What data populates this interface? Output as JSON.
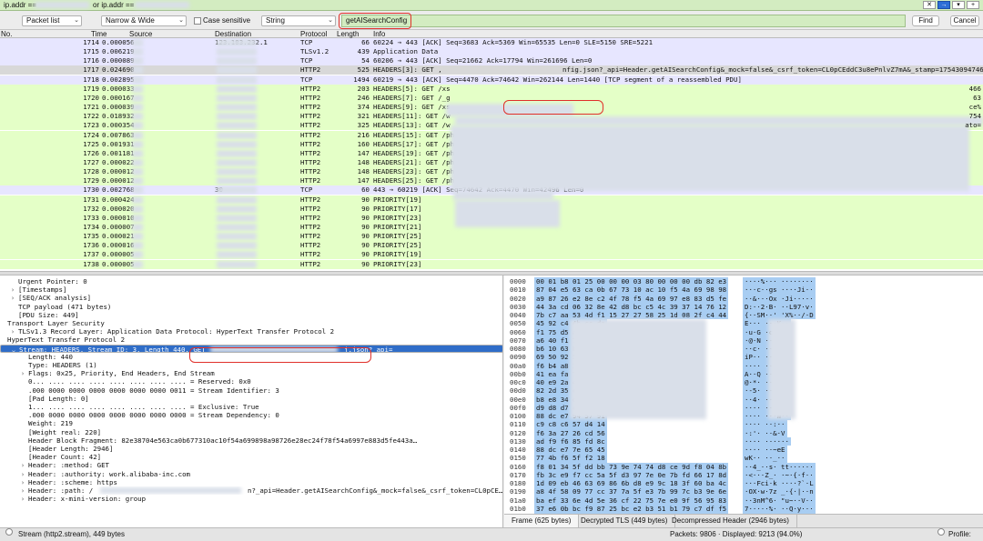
{
  "filter": {
    "text": "ip.addr ==",
    "or_text": "or ip.addr =="
  },
  "search": {
    "scope": "Packet list",
    "char_width": "Narrow & Wide",
    "case_label": "Case sensitive",
    "type": "String",
    "value": "getAISearchConfig",
    "find_label": "Find",
    "cancel_label": "Cancel"
  },
  "columns": [
    "No.",
    "Time",
    "Source",
    "Destination",
    "Protocol",
    "Length",
    "Info"
  ],
  "packets": [
    {
      "no": "1714",
      "time": "0.000056",
      "dst": "123.183.232.1",
      "proto": "TCP",
      "len": "66",
      "info": "60224 → 443 [ACK] Seq=3683 Ack=5369 Win=65535 Len=0 SLE=5150 SRE=5221",
      "kind": "tcp"
    },
    {
      "no": "1715",
      "time": "0.006219",
      "dst": "",
      "proto": "TLSv1.2",
      "len": "439",
      "info": "Application Data",
      "kind": "tcp"
    },
    {
      "no": "1716",
      "time": "0.000089",
      "dst": "",
      "proto": "TCP",
      "len": "54",
      "info": "60206 → 443 [ACK] Seq=21662 Ack=17794 Win=261696 Len=0",
      "kind": "tcp"
    },
    {
      "no": "1717",
      "time": "0.024690",
      "dst": "",
      "proto": "HTTP2",
      "len": "525",
      "info": "HEADERS[3]: GET ,",
      "info2": "nfig.json?_api=Header.getAISearchConfig&_mock=false&_csrf_token=CL0pCEddC3u8ePnlvZ7mA&_stamp=17543094746",
      "kind": "sel"
    },
    {
      "no": "1718",
      "time": "0.002895",
      "dst": "",
      "proto": "TCP",
      "len": "1494",
      "info": "60219 → 443 [ACK] Seq=4470 Ack=74642 Win=262144 Len=1440 [TCP segment of a reassembled PDU]",
      "kind": "tcp"
    },
    {
      "no": "1719",
      "time": "0.000033",
      "dst": "",
      "proto": "HTTP2",
      "len": "203",
      "info": "HEADERS[5]: GET /xs",
      "kind": "http2"
    },
    {
      "no": "1720",
      "time": "0.000167",
      "dst": "",
      "proto": "HTTP2",
      "len": "246",
      "info": "HEADERS[7]: GET /_g",
      "kind": "http2"
    },
    {
      "no": "1721",
      "time": "0.000039",
      "dst": "",
      "proto": "HTTP2",
      "len": "374",
      "info": "HEADERS[9]: GET /xs",
      "kind": "http2"
    },
    {
      "no": "1722",
      "time": "0.018932",
      "dst": "",
      "proto": "HTTP2",
      "len": "321",
      "info": "HEADERS[11]: GET /w",
      "kind": "http2"
    },
    {
      "no": "1723",
      "time": "0.000354",
      "dst": "",
      "proto": "HTTP2",
      "len": "325",
      "info": "HEADERS[13]: GET /w",
      "kind": "http2"
    },
    {
      "no": "1724",
      "time": "0.007863",
      "dst": "",
      "proto": "HTTP2",
      "len": "216",
      "info": "HEADERS[15]: GET /photo/undefined_80x80.jpg",
      "kind": "http2"
    },
    {
      "no": "1725",
      "time": "0.001931",
      "dst": "",
      "proto": "HTTP2",
      "len": "160",
      "info": "HEADERS[17]: GET /ph",
      "info2": "4309474653",
      "kind": "http2"
    },
    {
      "no": "1726",
      "time": "0.001181",
      "dst": "",
      "proto": "HTTP2",
      "len": "147",
      "info": "HEADERS[19]: GET /ph",
      "kind": "http2"
    },
    {
      "no": "1727",
      "time": "0.000022",
      "dst": "",
      "proto": "HTTP2",
      "len": "148",
      "info": "HEADERS[21]: GET /ph",
      "kind": "http2"
    },
    {
      "no": "1728",
      "time": "0.000012",
      "dst": "",
      "proto": "HTTP2",
      "len": "148",
      "info": "HEADERS[23]: GET /ph",
      "kind": "http2"
    },
    {
      "no": "1729",
      "time": "0.000012",
      "dst": "",
      "proto": "HTTP2",
      "len": "147",
      "info": "HEADERS[25]: GET /ph",
      "kind": "http2"
    },
    {
      "no": "1730",
      "time": "0.002768",
      "dst": "30",
      "proto": "TCP",
      "len": "60",
      "info": "443 → 60219 [ACK] Seq=74642 Ack=4470 Win=42496 Len=0",
      "kind": "tcp"
    },
    {
      "no": "1731",
      "time": "0.000424",
      "dst": "",
      "proto": "HTTP2",
      "len": "90",
      "info": "PRIORITY[19]",
      "kind": "http2"
    },
    {
      "no": "1732",
      "time": "0.000020",
      "dst": "",
      "proto": "HTTP2",
      "len": "90",
      "info": "PRIORITY[17]",
      "kind": "http2"
    },
    {
      "no": "1733",
      "time": "0.000010",
      "dst": "",
      "proto": "HTTP2",
      "len": "90",
      "info": "PRIORITY[23]",
      "kind": "http2"
    },
    {
      "no": "1734",
      "time": "0.000007",
      "dst": "",
      "proto": "HTTP2",
      "len": "90",
      "info": "PRIORITY[21]",
      "kind": "http2"
    },
    {
      "no": "1735",
      "time": "0.000021",
      "dst": "",
      "proto": "HTTP2",
      "len": "90",
      "info": "PRIORITY[25]",
      "kind": "http2"
    },
    {
      "no": "1736",
      "time": "0.000016",
      "dst": "",
      "proto": "HTTP2",
      "len": "90",
      "info": "PRIORITY[25]",
      "kind": "http2"
    },
    {
      "no": "1737",
      "time": "0.000005",
      "dst": "",
      "proto": "HTTP2",
      "len": "90",
      "info": "PRIORITY[19]",
      "kind": "http2"
    },
    {
      "no": "1738",
      "time": "0.000005",
      "dst": "",
      "proto": "HTTP2",
      "len": "90",
      "info": "PRIORITY[23]",
      "kind": "http2"
    }
  ],
  "info_tails": [
    {
      "row": 5,
      "text": "466"
    },
    {
      "row": 6,
      "text": "63"
    },
    {
      "row": 7,
      "text": "ce%"
    },
    {
      "row": 8,
      "text": "754"
    },
    {
      "row": 9,
      "text": "ato="
    }
  ],
  "details": [
    {
      "indent": 0,
      "arrow": "",
      "text": "Urgent Pointer: 0"
    },
    {
      "indent": 0,
      "arrow": "›",
      "text": "[Timestamps]"
    },
    {
      "indent": 0,
      "arrow": "›",
      "text": "[SEQ/ACK analysis]"
    },
    {
      "indent": 0,
      "arrow": "",
      "text": "TCP payload (471 bytes)"
    },
    {
      "indent": 0,
      "arrow": "",
      "text": "[PDU Size: 449]"
    },
    {
      "indent": -1,
      "arrow": "",
      "text": "Transport Layer Security"
    },
    {
      "indent": 0,
      "arrow": "›",
      "text": "TLSv1.3 Record Layer: Application Data Protocol: HyperText Transfer Protocol 2"
    },
    {
      "indent": -1,
      "arrow": "",
      "text": "HyperText Transfer Protocol 2"
    },
    {
      "indent": 0,
      "arrow": "⌄",
      "text": "Stream: HEADERS, Stream ID: 3, Length 440, GET",
      "text2": "j.json?_api=",
      "selected": true
    },
    {
      "indent": 1,
      "arrow": "",
      "text": "Length: 440"
    },
    {
      "indent": 1,
      "arrow": "",
      "text": "Type: HEADERS (1)"
    },
    {
      "indent": 1,
      "arrow": "›",
      "text": "Flags: 0x25, Priority, End Headers, End Stream"
    },
    {
      "indent": 1,
      "arrow": "",
      "text": "0... .... .... .... .... .... .... .... = Reserved: 0x0"
    },
    {
      "indent": 1,
      "arrow": "",
      "text": ".000 0000 0000 0000 0000 0000 0000 0011 = Stream Identifier: 3"
    },
    {
      "indent": 1,
      "arrow": "",
      "text": "[Pad Length: 0]"
    },
    {
      "indent": 1,
      "arrow": "",
      "text": "1... .... .... .... .... .... .... .... = Exclusive: True"
    },
    {
      "indent": 1,
      "arrow": "",
      "text": ".000 0000 0000 0000 0000 0000 0000 0000 = Stream Dependency: 0"
    },
    {
      "indent": 1,
      "arrow": "",
      "text": "Weight: 219"
    },
    {
      "indent": 1,
      "arrow": "",
      "text": "[Weight real: 220]"
    },
    {
      "indent": 1,
      "arrow": "",
      "text": "Header Block Fragment: 82e38704e563ca0b677310ac10f54a699898a98726e28ec24f78f54a6997e883d5fe443a…"
    },
    {
      "indent": 1,
      "arrow": "",
      "text": "[Header Length: 2946]"
    },
    {
      "indent": 1,
      "arrow": "",
      "text": "[Header Count: 42]"
    },
    {
      "indent": 1,
      "arrow": "›",
      "text": "Header: :method: GET"
    },
    {
      "indent": 1,
      "arrow": "›",
      "text": "Header: :authority: work.alibaba-inc.com"
    },
    {
      "indent": 1,
      "arrow": "›",
      "text": "Header: :scheme: https"
    },
    {
      "indent": 1,
      "arrow": "›",
      "text": "Header: :path: /",
      "text2": "n?_api=Header.getAISearchConfig&_mock=false&_csrf_token=CL0pCE…"
    },
    {
      "indent": 1,
      "arrow": "›",
      "text": "Header: x-mini-version: group"
    }
  ],
  "hex": [
    {
      "off": "0000",
      "hex": "00 01 b8 01 25 00 00 00  03 80 00 00 00 db 82 e3",
      "asc": "····%··· ········"
    },
    {
      "off": "0010",
      "hex": "87 04 e5 63 ca 0b 67 73  10 ac 10 f5 4a 69 98 98",
      "asc": "···c··gs ····Ji··"
    },
    {
      "off": "0020",
      "hex": "a9 87 26 e2 8e c2 4f 78  f5 4a 69 97 e8 83 d5 fe",
      "asc": "··&···Ox ·Ji·····"
    },
    {
      "off": "0030",
      "hex": "44 3a cd 06 32 8e 42 d8  bc c5 4c 39 37 14 76 12",
      "asc": "D:··2·B· ··L97·v·"
    },
    {
      "off": "0040",
      "hex": "7b c7 aa 53 4d f1 15 27  27 58 25 1d 08 2f c4 44",
      "asc": "{··SM··' 'X%··/·D"
    },
    {
      "off": "0050",
      "hex": "45 92 c4                          4b cc da",
      "asc": "E···     ···K··"
    },
    {
      "off": "0060",
      "hex": "f1 75 d5                          a0 63 23",
      "asc": "·u·G     ·cM6··"
    },
    {
      "off": "0070",
      "hex": "a6 40 f1                          7a d6 ee",
      "asc": "·@·N     ···z··"
    },
    {
      "off": "0080",
      "hex": "b6 10 63                          b5 85 ed",
      "asc": "··c·     ·····"
    },
    {
      "off": "0090",
      "hex": "69 50 92                          53 5e d2",
      "asc": "iP··     ···S^·"
    },
    {
      "off": "00a0",
      "hex": "f6 b4 a8                          3d 4c 74",
      "asc": "····     ···=Lt"
    },
    {
      "off": "00b0",
      "hex": "41 ea fa                          7f 1e 88",
      "asc": "A··Q     ······"
    },
    {
      "off": "00c0",
      "hex": "40 e9 2a                          47 7f 1d",
      "asc": "@·*·     ···G··"
    },
    {
      "off": "00d0",
      "hex": "82 2d 35                          c1 ec ea",
      "asc": "·-5·     ······"
    },
    {
      "off": "00e0",
      "hex": "b8 e8 34                          dc db da",
      "asc": "··4·     ······"
    },
    {
      "off": "00f0",
      "hex": "d9 d8 d7                          cc cb ca",
      "asc": "····     ······"
    },
    {
      "off": "0100",
      "hex": "88 dc e7                          94 57 91",
      "asc": "····     ···W··"
    },
    {
      "off": "0110",
      "hex": "c9 c8 c6                          57 d4 14",
      "asc": "····     ··:··"
    },
    {
      "off": "0120",
      "hex": "f6 3a 27                          26 cd 56",
      "asc": "·:'·     ··&·V"
    },
    {
      "off": "0130",
      "hex": "ad f9 f6                          85 fd 8c",
      "asc": "····     ······"
    },
    {
      "off": "0140",
      "hex": "88 dc e7                          7e 65 45",
      "asc": "····     ··~eE"
    },
    {
      "off": "0150",
      "hex": "77 4b f6                          5f f2 18",
      "asc": "wK··     ··_··"
    },
    {
      "off": "0160",
      "hex": "f8 01 34 5f dd bb 73 9e  74 74 d8 ce 9d f8 04 8b",
      "asc": "··4_··s· tt······"
    },
    {
      "off": "0170",
      "hex": "fb 3c e9 f7 cc 5a 5f d3  97 7e 0e 7b fd 66 17 8d",
      "asc": "·<···Z_· ·~·{·f··"
    },
    {
      "off": "0180",
      "hex": "1d 09 eb 46 63 69 86 6b  d8 e9 9c 18 3f 60 ba 4c",
      "asc": "···Fci·k ····?`·L"
    },
    {
      "off": "0190",
      "hex": "a8 4f 58 09 77 cc 37 7a  5f e3 7b 99 7c b3 9e 6e",
      "asc": "·OX·w·7z _·{·|··n"
    },
    {
      "off": "01a0",
      "hex": "ba ef 33 6e 4d 5e 36 cf  22 75 7e e0 9f 56 95 83",
      "asc": "··3nM^6· \"u~··V··"
    },
    {
      "off": "01b0",
      "hex": "37 e6 0b bc f9 87 25 bc  e2 b3 51 b1 79 c7 df f5",
      "asc": "7·····%· ··Q·y···"
    },
    {
      "off": "01c0",
      "hex": "14 d1 a8 38 74 73 bc ba  ff 7f 08 85 b6 00 fd 28",
      "asc": "···8ts·· ·······("
    },
    {
      "off": "01d0",
      "hex": "6f",
      "asc": "o"
    }
  ],
  "hex_tabs": [
    "Frame (625 bytes)",
    "Decrypted TLS (449 bytes)",
    "Decompressed Header (2946 bytes)"
  ],
  "status": {
    "left": "Stream (http2.stream), 449 bytes",
    "packets": "Packets: 9806 · Displayed: 9213 (94.0%)",
    "profile": "Profile: Defa"
  }
}
